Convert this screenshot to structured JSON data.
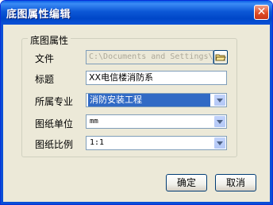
{
  "dialog": {
    "title": "底图属性编辑",
    "close_symbol": "✕"
  },
  "group": {
    "title": "底图属性"
  },
  "fields": {
    "file": {
      "label": "文件",
      "value": "C:\\Documents and Settings\\Adm",
      "browse_icon": "open-folder-icon"
    },
    "title": {
      "label": "标题",
      "value": "XX电信楼消防系"
    },
    "specialty": {
      "label": "所属专业",
      "value": "消防安装工程"
    },
    "unit": {
      "label": "图纸单位",
      "value": "mm"
    },
    "scale": {
      "label": "图纸比例",
      "value": "1:1"
    }
  },
  "buttons": {
    "ok": "确定",
    "cancel": "取消"
  }
}
